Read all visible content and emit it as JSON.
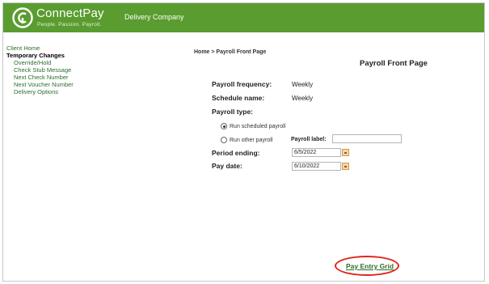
{
  "header": {
    "brand": "ConnectPay",
    "tagline": "People. Passion. Payroll.",
    "company": "Delivery Company",
    "colors": {
      "header_bg": "#5a9c2f",
      "link": "#2b6f2b",
      "highlight": "#e0261a"
    }
  },
  "sidebar": {
    "home": "Client Home",
    "section": "Temporary Changes",
    "items": [
      "Override/Hold",
      "Check Stub Message",
      "Next Check Number",
      "Next Voucher Number",
      "Delivery Options"
    ]
  },
  "breadcrumb": "Home > Payroll Front Page",
  "page_title": "Payroll Front Page",
  "form": {
    "frequency_label": "Payroll frequency:",
    "frequency_value": "Weekly",
    "schedule_label": "Schedule name:",
    "schedule_value": "Weekly",
    "type_label": "Payroll type:",
    "radio_scheduled": "Run scheduled payroll",
    "radio_other": "Run other payroll",
    "payroll_label_label": "Payroll label:",
    "payroll_label_value": "",
    "period_label": "Period ending:",
    "period_value": "6/5/2022",
    "paydate_label": "Pay date:",
    "paydate_value": "6/10/2022"
  },
  "pay_entry_link": "Pay Entry Grid",
  "icons": [
    "connectpay-logo-icon",
    "calendar-icon",
    "radio-checked-icon",
    "radio-unchecked-icon"
  ]
}
